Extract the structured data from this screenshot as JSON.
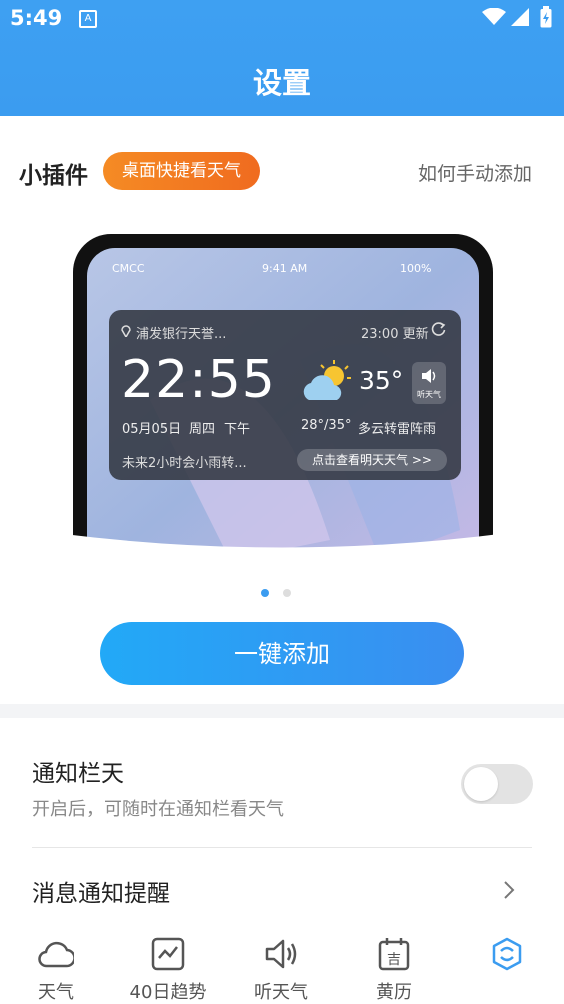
{
  "status": {
    "time": "5:49",
    "icon_a": "A"
  },
  "header": {
    "title": "设置"
  },
  "widget": {
    "title": "小插件",
    "tag": "桌面快捷看天气",
    "howto": "如何手动添加",
    "preview": {
      "carrier": "CMCC",
      "phone_time": "9:41 AM",
      "battery": "100%",
      "location": "浦发银行天誉...",
      "updated": "23:00 更新",
      "time": "22:55",
      "date": "05月05日",
      "weekday": "周四",
      "period": "下午",
      "temp": "35°",
      "listen": "听天气",
      "range": "28°/35°",
      "desc": "多云转雷阵雨",
      "rain_tip": "未来2小时会小雨转...",
      "tomorrow_btn": "点击查看明天天气 >>"
    },
    "add_button": "一键添加"
  },
  "settings": {
    "notify_title": "通知栏天",
    "notify_sub": "开启后，可随时在通知栏看天气",
    "notify_enabled": false,
    "remind_title": "消息通知提醒"
  },
  "tabs": [
    {
      "label": "天气",
      "icon": "cloud-icon"
    },
    {
      "label": "40日趋势",
      "icon": "trend-icon"
    },
    {
      "label": "听天气",
      "icon": "speaker-icon"
    },
    {
      "label": "黄历",
      "icon": "calendar-icon"
    },
    {
      "label": "",
      "icon": "settings-tab-icon"
    }
  ],
  "colors": {
    "primary": "#3b9cf0",
    "tag": "#f27a22"
  }
}
